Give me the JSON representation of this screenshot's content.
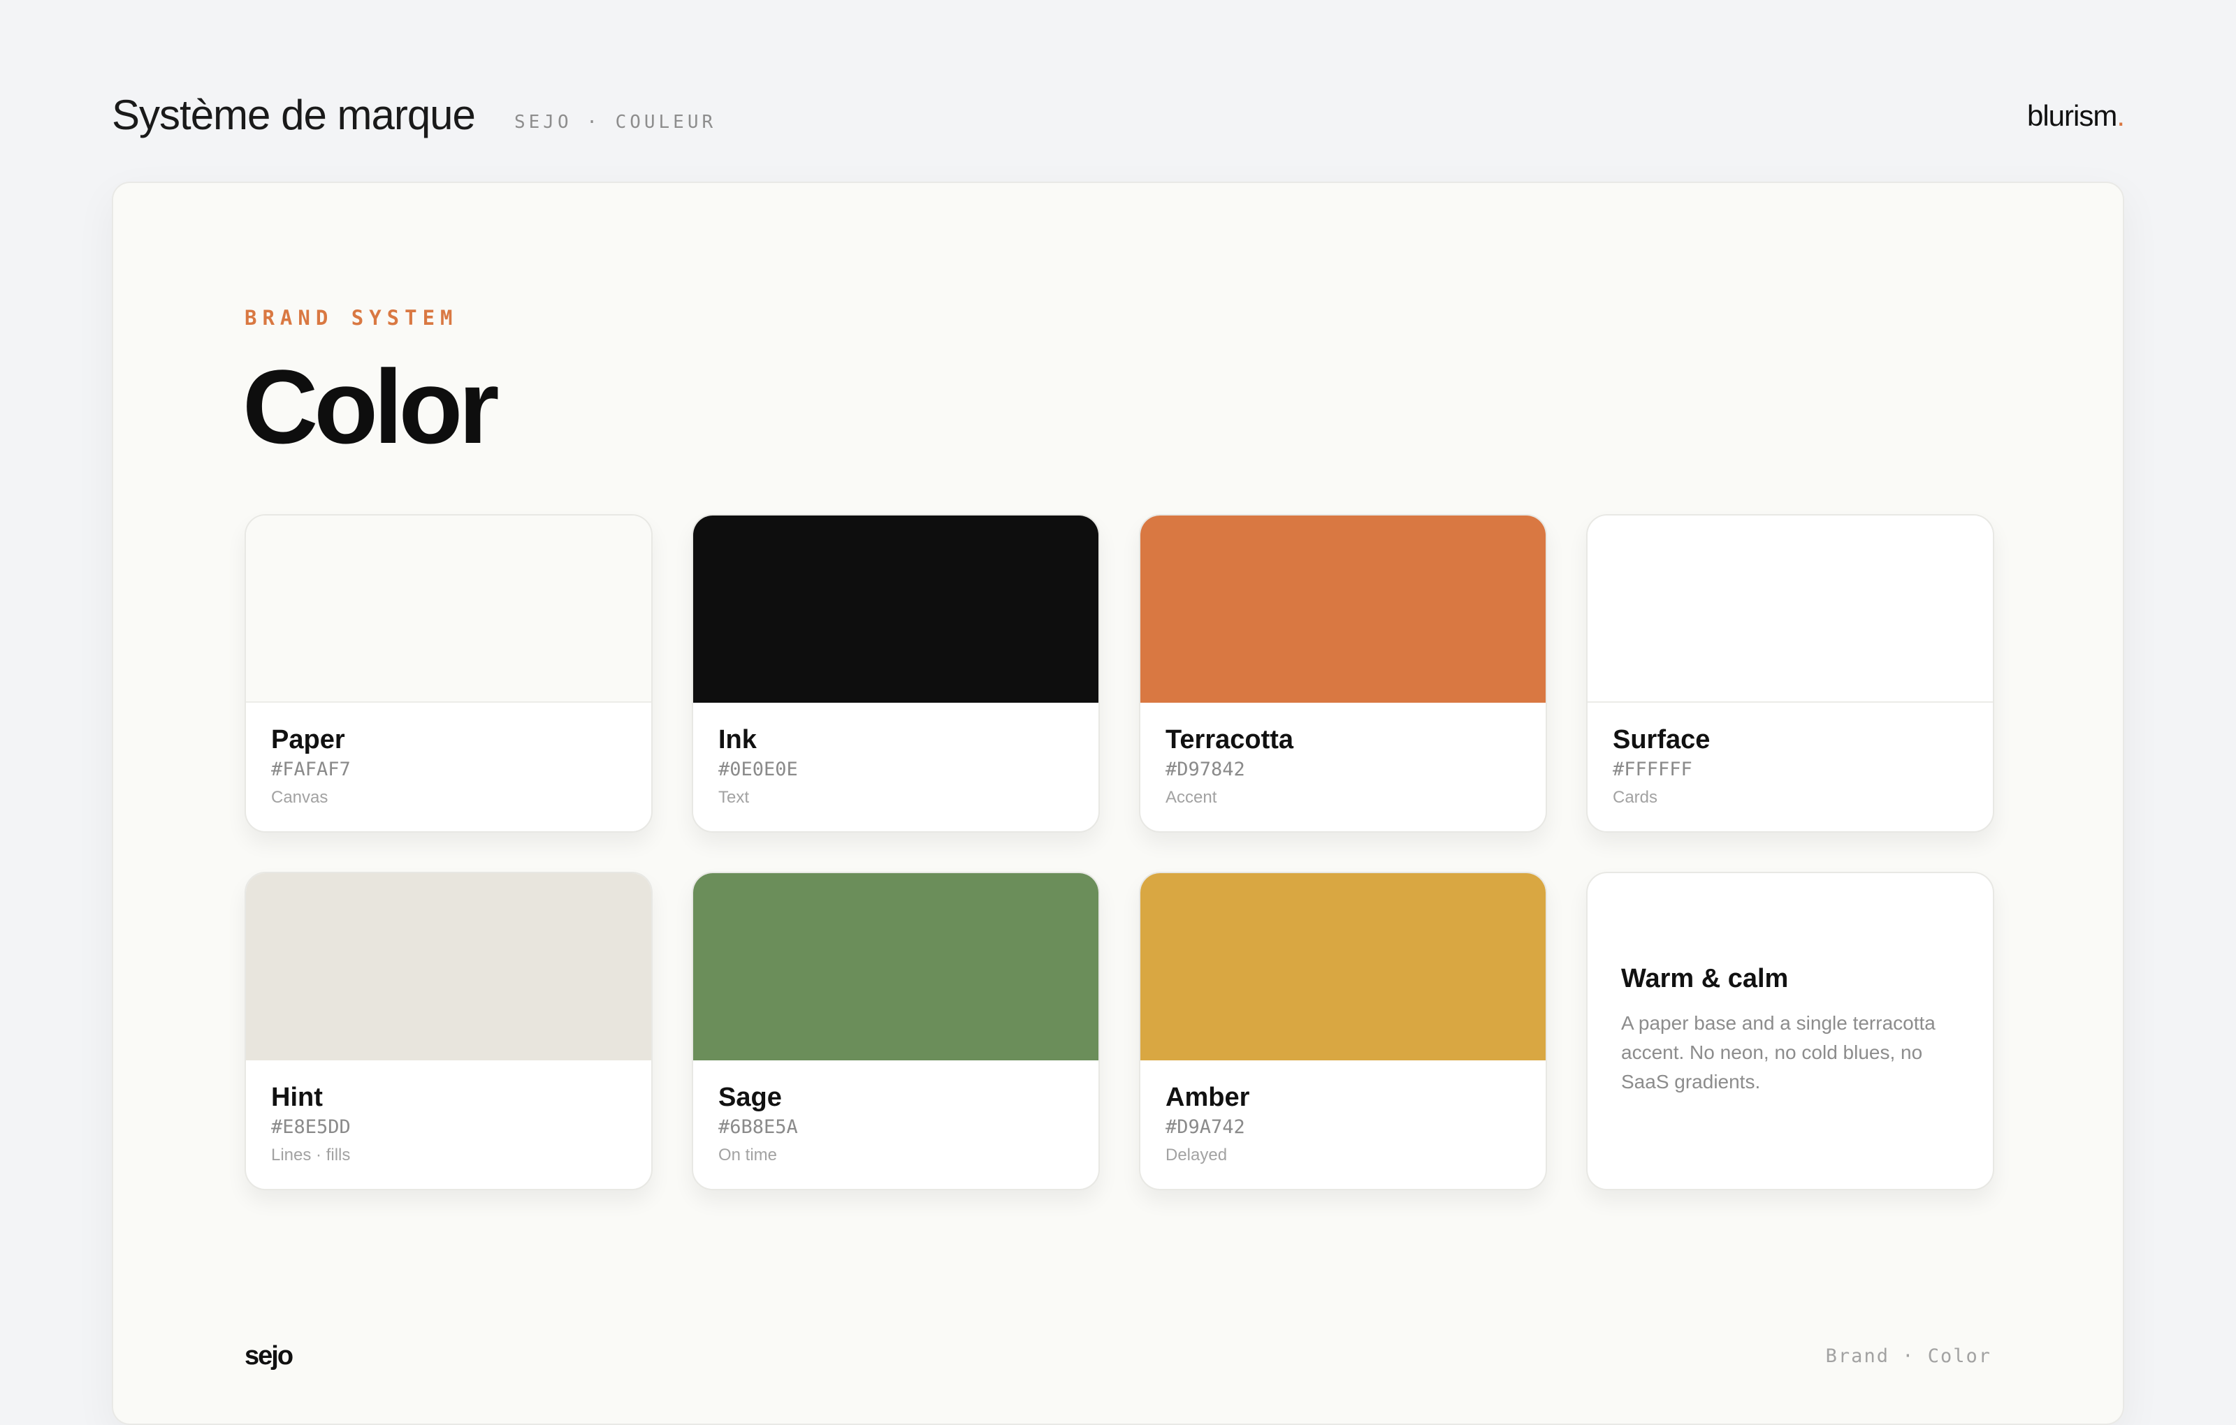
{
  "header": {
    "title": "Système de marque",
    "subtitle": "SEJO · COULEUR",
    "logo_text": "blurism",
    "logo_dot": "."
  },
  "main": {
    "eyebrow": "BRAND SYSTEM",
    "headline": "Color",
    "swatches": [
      {
        "name": "Paper",
        "hex": "#FAFAF7",
        "role": "Canvas",
        "color": "#FAFAF7"
      },
      {
        "name": "Ink",
        "hex": "#0E0E0E",
        "role": "Text",
        "color": "#0E0E0E"
      },
      {
        "name": "Terracotta",
        "hex": "#D97842",
        "role": "Accent",
        "color": "#D97842"
      },
      {
        "name": "Surface",
        "hex": "#FFFFFF",
        "role": "Cards",
        "color": "#FFFFFF"
      },
      {
        "name": "Hint",
        "hex": "#E8E5DD",
        "role": "Lines · fills",
        "color": "#E8E5DD"
      },
      {
        "name": "Sage",
        "hex": "#6B8E5A",
        "role": "On time",
        "color": "#6B8E5A"
      },
      {
        "name": "Amber",
        "hex": "#D9A742",
        "role": "Delayed",
        "color": "#D9A742"
      }
    ],
    "note": {
      "title": "Warm & calm",
      "body": "A paper base and a single terracotta accent. No neon, no cold blues, no SaaS gradients."
    }
  },
  "footer": {
    "logo": "sejo",
    "caption": "Brand · Color"
  }
}
